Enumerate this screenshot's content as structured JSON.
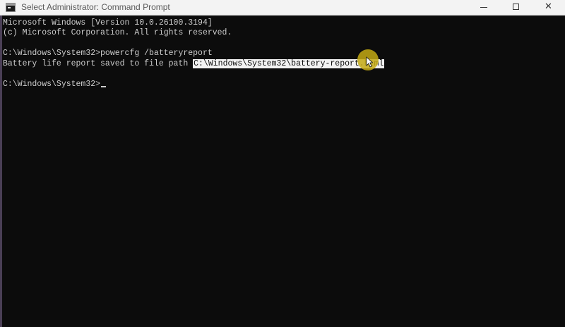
{
  "window": {
    "title": "Select Administrator: Command Prompt",
    "controls": {
      "minimize": "minimize-icon",
      "maximize": "maximize-icon",
      "close": "✕"
    }
  },
  "console": {
    "lines": {
      "version": "Microsoft Windows [Version 10.0.26100.3194]",
      "copyright": "(c) Microsoft Corporation. All rights reserved.",
      "command_prompt": "C:\\Windows\\System32>",
      "command": "powercfg /batteryreport",
      "result_prefix": "Battery life report saved to file path ",
      "result_path": "C:\\Windows\\System32\\battery-report.html",
      "current_prompt": "C:\\Windows\\System32>"
    }
  },
  "colors": {
    "console_background": "#0c0c0c",
    "console_text": "#cccccc",
    "selection": "#f2f2f2",
    "click_highlight": "#c4aa14"
  }
}
